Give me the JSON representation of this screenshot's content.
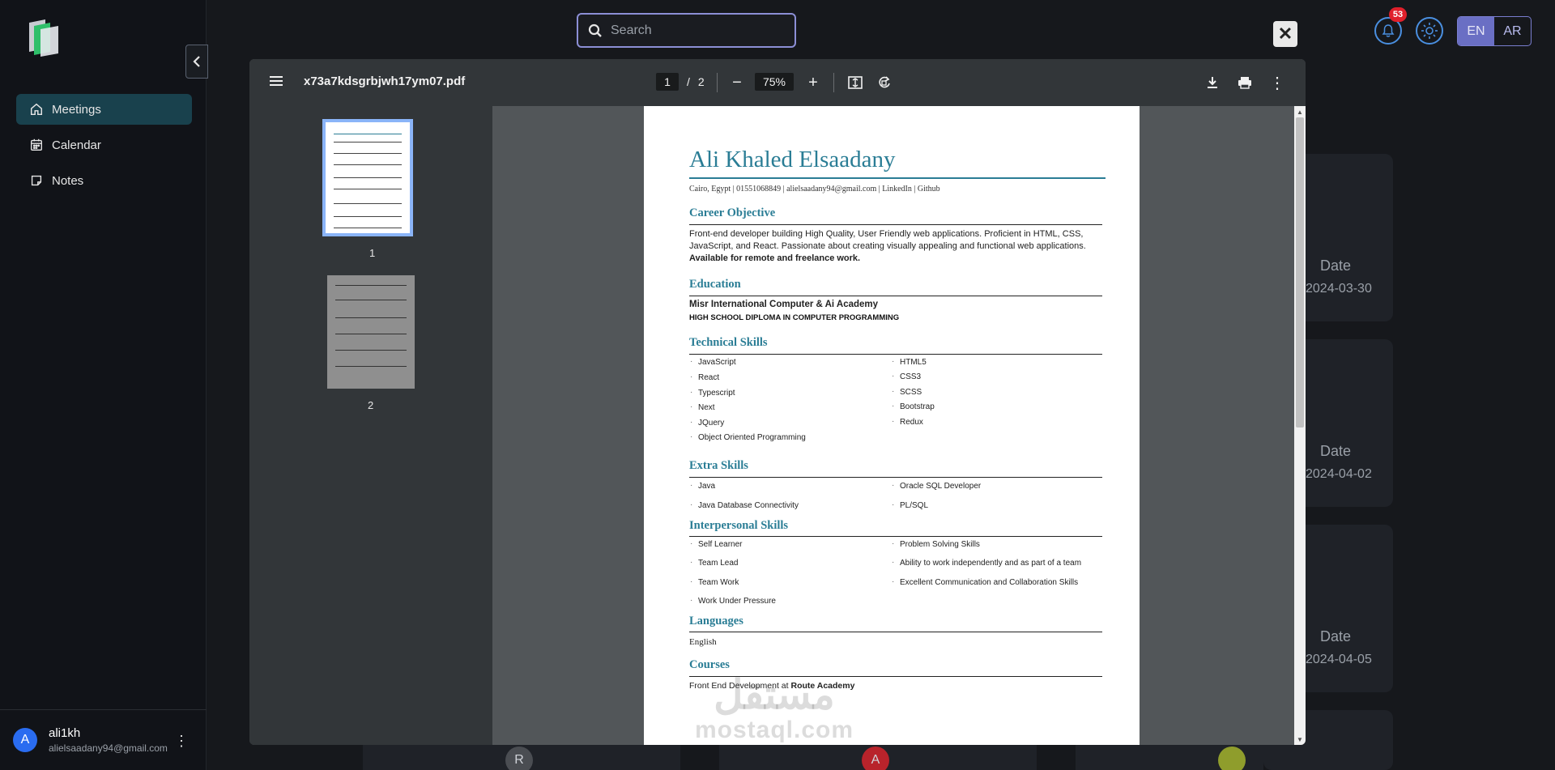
{
  "sidebar": {
    "items": [
      {
        "label": "Meetings",
        "icon": "home-icon",
        "active": true
      },
      {
        "label": "Calendar",
        "icon": "calendar-icon",
        "active": false
      },
      {
        "label": "Notes",
        "icon": "notes-icon",
        "active": false
      }
    ],
    "user": {
      "initial": "A",
      "name": "ali1kh",
      "email": "alielsaadany94@gmail.com"
    }
  },
  "header": {
    "search": {
      "placeholder": "Search",
      "value": ""
    },
    "notifications_count": "53",
    "lang": {
      "active": "EN",
      "inactive": "AR"
    }
  },
  "background_cards": [
    {
      "label": "Date",
      "value": "2024-03-30"
    },
    {
      "label": "Date",
      "value": "2024-04-02"
    },
    {
      "label": "Date",
      "value": "2024-04-05"
    }
  ],
  "bottom_avatars": [
    "R",
    "A",
    ""
  ],
  "pdf": {
    "filename": "x73a7kdsgrbjwh17ym07.pdf",
    "current_page": "1",
    "separator": "/",
    "total_pages": "2",
    "zoom": "75%",
    "thumb_numbers": [
      "1",
      "2"
    ]
  },
  "resume": {
    "name": "Ali Khaled Elsaadany",
    "contact": "Cairo, Egypt | 01551068849 | alielsaadany94@gmail.com | LinkedIn | Github",
    "career_title": "Career Objective",
    "career_text": "Front-end developer building High Quality, User Friendly web applications. Proficient in HTML, CSS, JavaScript, and React. Passionate about creating visually appealing and functional web applications.",
    "career_bold": "Available for remote and freelance work.",
    "education_title": "Education",
    "school": "Misr International Computer & Ai Academy",
    "degree": "HIGH SCHOOL DIPLOMA IN COMPUTER PROGRAMMING",
    "tech_title": "Technical Skills",
    "tech_left": [
      "JavaScript",
      "React",
      "Typescript",
      "Next",
      "JQuery",
      "Object Oriented Programming"
    ],
    "tech_right": [
      "HTML5",
      "CSS3",
      "SCSS",
      "Bootstrap",
      "Redux"
    ],
    "extra_title": "Extra Skills",
    "extra_left": [
      "Java",
      "Java Database Connectivity"
    ],
    "extra_right": [
      "Oracle SQL Developer",
      "PL/SQL"
    ],
    "inter_title": "Interpersonal Skills",
    "inter_left": [
      "Self Learner",
      "Team Lead",
      "Team Work",
      "Work Under Pressure"
    ],
    "inter_right": [
      "Problem Solving Skills",
      "Ability to work independently and as part of a team",
      "Excellent Communication and Collaboration Skills"
    ],
    "lang_title": "Languages",
    "languages": "English",
    "courses_title": "Courses",
    "course_prefix": "Front End Development at ",
    "course_bold": "Route Academy"
  },
  "watermark": {
    "arabic": "مستقل",
    "latin": "mostaql.com"
  }
}
